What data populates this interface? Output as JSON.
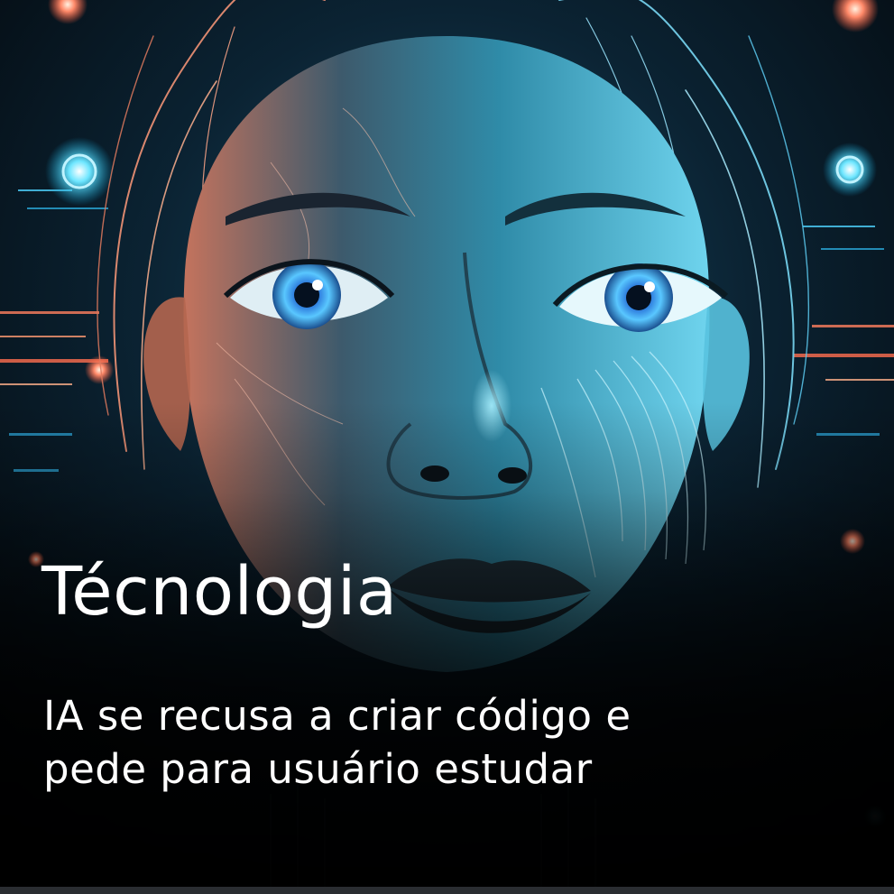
{
  "card": {
    "category": "Técnologia",
    "headline_line1": "IA se recusa a criar código e",
    "headline_line2": "pede para usuário estudar",
    "image_subject": "ai-face-illustration"
  },
  "colors": {
    "background": "#05080c",
    "cyan_glow": "#4fd3ff",
    "warm_glow": "#ff8a6a",
    "text": "#ffffff",
    "bottom_bar": "#2a2d31"
  }
}
